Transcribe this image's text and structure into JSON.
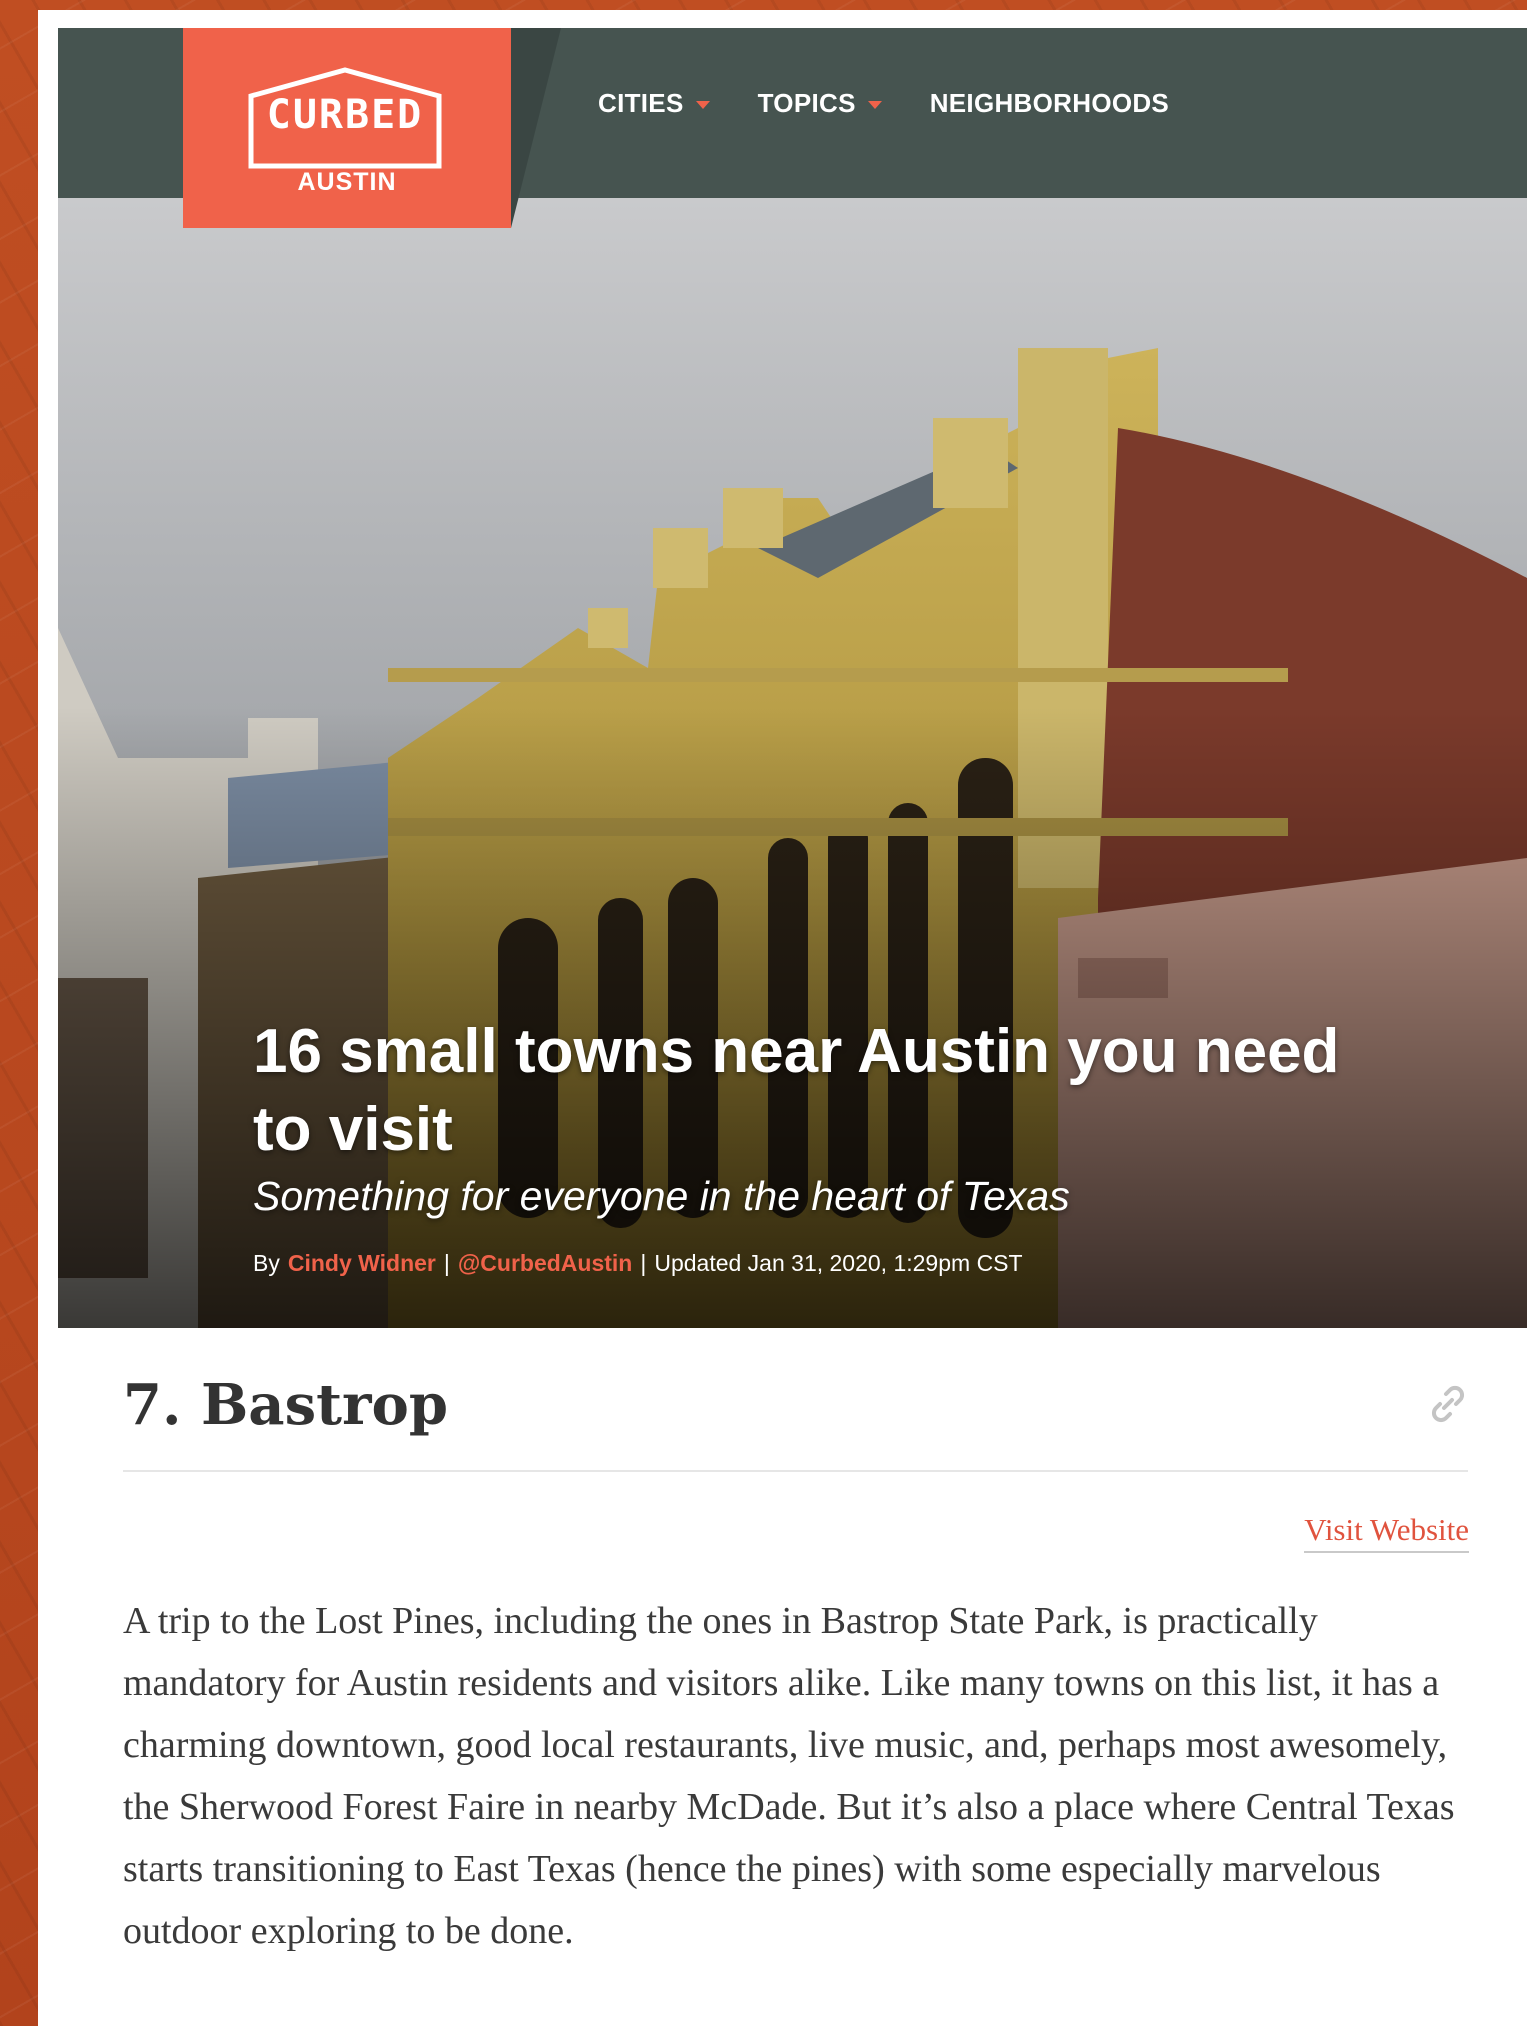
{
  "header": {
    "logo_word": "CURBED",
    "logo_city": "AUSTIN",
    "nav": [
      {
        "label": "CITIES",
        "dropdown": true
      },
      {
        "label": "TOPICS",
        "dropdown": true
      },
      {
        "label": "NEIGHBORHOODS",
        "dropdown": false
      }
    ]
  },
  "hero": {
    "title": "16 small towns near Austin you need to visit",
    "subtitle": "Something for everyone in the heart of Texas",
    "byline": {
      "by": "By",
      "author": "Cindy Widner",
      "handle": "@CurbedAustin",
      "updated": "Updated Jan 31, 2020, 1:29pm CST"
    }
  },
  "entry": {
    "title": "7. Bastrop",
    "visit_label": "Visit Website",
    "body": "A trip to the Lost Pines, including the ones in Bastrop State Park, is practically mandatory for Austin residents and visitors alike. Like many towns on this list, it has a charming downtown, good local restaurants, live music, and, perhaps most awesomely, the Sherwood Forest Faire in nearby McDade. But it’s also a place where Central Texas starts transitioning to East Texas (hence the pines) with some especially marvelous outdoor exploring to be done."
  },
  "colors": {
    "brand": "#f0624a",
    "nav_bg": "#465450",
    "frame": "#b5461e"
  },
  "icons": {
    "link": "link-icon",
    "caret": "chevron-down-icon"
  }
}
